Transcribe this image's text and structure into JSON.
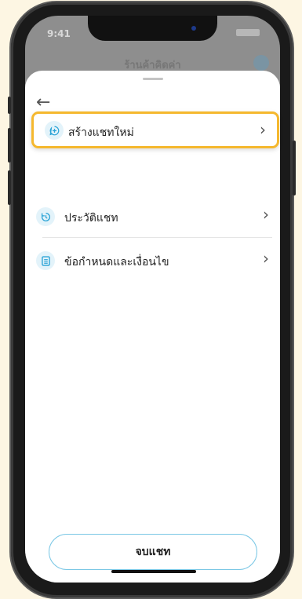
{
  "status_bar": {
    "time": "9:41"
  },
  "background": {
    "title": "ร้านค้าคิดค่า"
  },
  "sheet": {
    "menu": [
      {
        "label": "สร้างแชทใหม่",
        "icon": "plus-circle-icon",
        "highlighted": true
      },
      {
        "label": "ประวัติแชท",
        "icon": "history-icon"
      },
      {
        "label": "ข้อกำหนดและเงื่อนไข",
        "icon": "document-icon"
      }
    ],
    "end_chat_label": "จบแชท"
  },
  "colors": {
    "highlight_border": "#f5b82e",
    "icon_bg": "#e3f3fa",
    "icon_fg": "#2aa3d6",
    "button_border": "#7ac7e5",
    "page_bg": "#fdf6e3"
  }
}
